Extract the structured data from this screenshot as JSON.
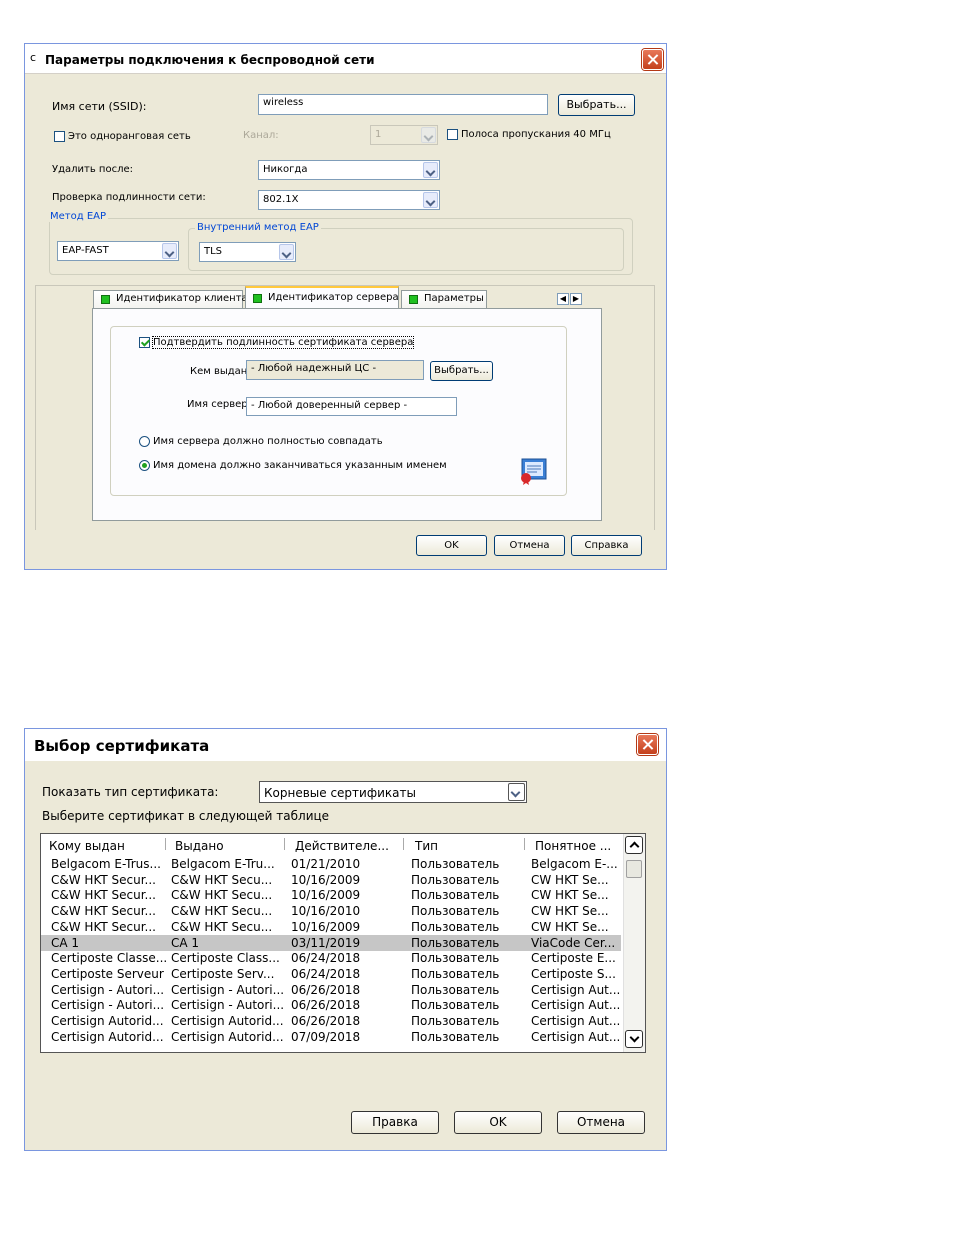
{
  "dialog1": {
    "title": "Параметры подключения к беспроводной сети",
    "ssid_label": "Имя сети (SSID):",
    "ssid_value": "wireless",
    "select_button": "Выбрать...",
    "adhoc_label": "Это одноранговая сеть",
    "adhoc_checked": false,
    "channel_label": "Канал:",
    "channel_value": "1",
    "bandwidth_label": "Полоса пропускания 40 МГц",
    "bandwidth_checked": false,
    "delete_after_label": "Удалить после:",
    "delete_after_value": "Никогда",
    "auth_label": "Проверка подлинности сети:",
    "auth_value": "802.1X",
    "eap_method_legend": "Метод EAP",
    "eap_method_value": "EAP-FAST",
    "inner_eap_legend": "Внутренний метод EAP",
    "inner_eap_value": "TLS",
    "tabs": [
      {
        "label": "Идентификатор клиента",
        "active": false
      },
      {
        "label": "Идентификатор сервера",
        "active": true
      },
      {
        "label": "Параметры",
        "active": false
      }
    ],
    "verify_cert_label": "Подтвердить подлинность сертификата сервера",
    "verify_cert_checked": true,
    "issued_by_label": "Кем выдан:",
    "issued_by_value": "- Любой надежный ЦС -",
    "issued_by_button": "Выбрать...",
    "server_name_label": "Имя сервера:",
    "server_name_value": "- Любой доверенный сервер -",
    "radio_exact": "Имя сервера должно полностью совпадать",
    "radio_domain": "Имя домена должно заканчиваться указанным именем",
    "selected_radio": "domain",
    "ok_button": "OK",
    "cancel_button": "Отмена",
    "help_button": "Справка"
  },
  "dialog2": {
    "title": "Выбор сертификата",
    "show_type_label": "Показать тип сертификата:",
    "show_type_value": "Корневые сертификаты",
    "instruction": "Выберите сертификат в следующей таблице",
    "columns": [
      "Кому выдан",
      "Выдано",
      "Действителе...",
      "Тип",
      "Понятное ..."
    ],
    "rows": [
      [
        "Belgacom E-Trus...",
        "Belgacom E-Tru...",
        "01/21/2010",
        "Пользователь",
        "Belgacom E-..."
      ],
      [
        "C&W HKT Secur...",
        "C&W HKT Secu...",
        "10/16/2009",
        "Пользователь",
        "CW HKT Se..."
      ],
      [
        "C&W HKT Secur...",
        "C&W HKT Secu...",
        "10/16/2009",
        "Пользователь",
        "CW HKT Se..."
      ],
      [
        "C&W HKT Secur...",
        "C&W HKT Secu...",
        "10/16/2010",
        "Пользователь",
        "CW HKT Se..."
      ],
      [
        "C&W HKT Secur...",
        "C&W HKT Secu...",
        "10/16/2009",
        "Пользователь",
        "CW HKT Se..."
      ],
      [
        "CA 1",
        "CA 1",
        "03/11/2019",
        "Пользователь",
        "ViaCode Cer..."
      ],
      [
        "Certiposte Classe...",
        "Certiposte Class...",
        "06/24/2018",
        "Пользователь",
        "Certiposte E..."
      ],
      [
        "Certiposte Serveur",
        "Certiposte Serv...",
        "06/24/2018",
        "Пользователь",
        "Certiposte S..."
      ],
      [
        "Certisign - Autori...",
        "Certisign - Autori...",
        "06/26/2018",
        "Пользователь",
        "Certisign Aut..."
      ],
      [
        "Certisign - Autori...",
        "Certisign - Autori...",
        "06/26/2018",
        "Пользователь",
        "Certisign Aut..."
      ],
      [
        "Certisign Autorid...",
        "Certisign Autorid...",
        "06/26/2018",
        "Пользователь",
        "Certisign Aut..."
      ],
      [
        "Certisign Autorid...",
        "Certisign Autorid...",
        "07/09/2018",
        "Пользователь",
        "Certisign Aut..."
      ]
    ],
    "selected_row": 5,
    "edit_button": "Правка",
    "ok_button": "OK",
    "cancel_button": "Отмена"
  }
}
